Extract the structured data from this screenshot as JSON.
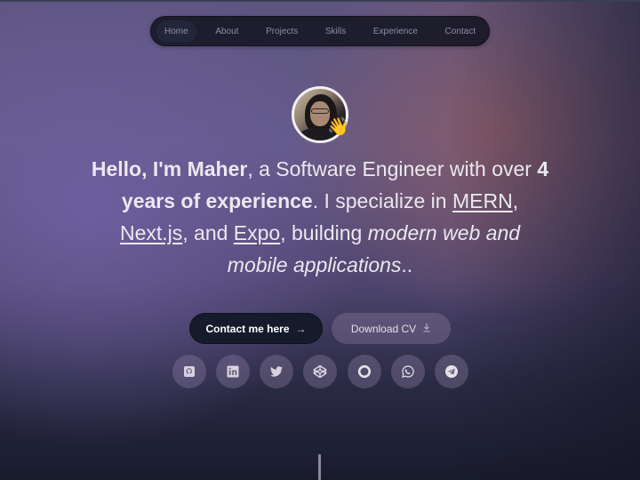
{
  "nav": {
    "items": [
      {
        "label": "Home",
        "active": true
      },
      {
        "label": "About",
        "active": false
      },
      {
        "label": "Projects",
        "active": false
      },
      {
        "label": "Skills",
        "active": false
      },
      {
        "label": "Experience",
        "active": false
      },
      {
        "label": "Contact",
        "active": false
      }
    ]
  },
  "hero": {
    "avatar_alt": "Profile photo of Maher",
    "wave_emoji": "👋",
    "headline": {
      "greeting_bold": "Hello, I'm Maher",
      "part1": ", a Software Engineer with over ",
      "experience_bold": "4 years of experience",
      "part2": ". I specialize in ",
      "tech1": "MERN",
      "sep1": ", ",
      "tech2": "Next.js",
      "sep2": ", and ",
      "tech3": "Expo",
      "part3": ", building ",
      "italic": "modern web and mobile applications",
      "ending": ".."
    }
  },
  "buttons": {
    "contact_label": "Contact me here",
    "contact_icon": "→",
    "cv_label": "Download CV",
    "cv_icon": "⤓"
  },
  "socials": [
    {
      "name": "github",
      "icon": "github-icon"
    },
    {
      "name": "linkedin",
      "icon": "linkedin-icon"
    },
    {
      "name": "twitter",
      "icon": "twitter-icon"
    },
    {
      "name": "codepen",
      "icon": "codepen-icon"
    },
    {
      "name": "circle",
      "icon": "circle-icon"
    },
    {
      "name": "whatsapp",
      "icon": "whatsapp-icon"
    },
    {
      "name": "telegram",
      "icon": "telegram-icon"
    }
  ],
  "colors": {
    "nav_bg": "#181826",
    "nav_text": "#8d8ca6",
    "contact_btn_bg": "#161b2c",
    "text_primary": "#ebe8ef"
  }
}
